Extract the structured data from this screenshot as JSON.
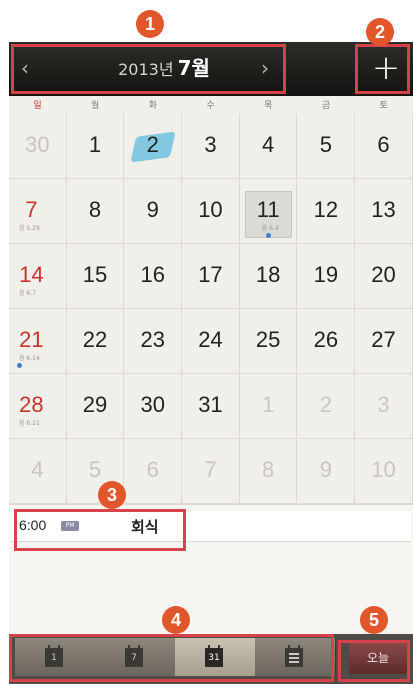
{
  "header": {
    "prev_icon": "chevron-left-icon",
    "next_icon": "chevron-right-icon",
    "year_label": "2013년",
    "month_label": "7월",
    "add_label": "+"
  },
  "weekdays": [
    "일",
    "월",
    "화",
    "수",
    "목",
    "금",
    "토"
  ],
  "weeks": [
    [
      {
        "d": "30",
        "o": true
      },
      {
        "d": "1"
      },
      {
        "d": "2",
        "today": true
      },
      {
        "d": "3"
      },
      {
        "d": "4"
      },
      {
        "d": "5"
      },
      {
        "d": "6"
      }
    ],
    [
      {
        "d": "7",
        "s": true,
        "l": "음 5.29"
      },
      {
        "d": "8"
      },
      {
        "d": "9"
      },
      {
        "d": "10"
      },
      {
        "d": "11",
        "sel": true,
        "l": "음 6.4",
        "dot": true
      },
      {
        "d": "12"
      },
      {
        "d": "13"
      }
    ],
    [
      {
        "d": "14",
        "s": true,
        "l": "음 6.7"
      },
      {
        "d": "15"
      },
      {
        "d": "16"
      },
      {
        "d": "17"
      },
      {
        "d": "18"
      },
      {
        "d": "19"
      },
      {
        "d": "20"
      }
    ],
    [
      {
        "d": "21",
        "s": true,
        "l": "음 6.14",
        "dot": true
      },
      {
        "d": "22"
      },
      {
        "d": "23"
      },
      {
        "d": "24"
      },
      {
        "d": "25"
      },
      {
        "d": "26"
      },
      {
        "d": "27"
      }
    ],
    [
      {
        "d": "28",
        "s": true,
        "l": "음 6.21"
      },
      {
        "d": "29"
      },
      {
        "d": "30"
      },
      {
        "d": "31"
      },
      {
        "d": "1",
        "o": true
      },
      {
        "d": "2",
        "o": true
      },
      {
        "d": "3",
        "o": true
      }
    ],
    [
      {
        "d": "4",
        "o": true
      },
      {
        "d": "5",
        "o": true
      },
      {
        "d": "6",
        "o": true
      },
      {
        "d": "7",
        "o": true
      },
      {
        "d": "8",
        "o": true
      },
      {
        "d": "9",
        "o": true
      },
      {
        "d": "10",
        "o": true
      }
    ]
  ],
  "event": {
    "time": "6:00",
    "ampm": "PM",
    "title": "회식"
  },
  "bottom_tabs": [
    {
      "label": "1",
      "name": "tab-day-view"
    },
    {
      "label": "7",
      "name": "tab-week-view"
    },
    {
      "label": "31",
      "name": "tab-month-view",
      "active": true
    },
    {
      "label": "",
      "name": "tab-list-view"
    }
  ],
  "today_button": "오늘",
  "callouts": [
    "1",
    "2",
    "3",
    "4",
    "5"
  ],
  "colors": {
    "accent": "#e2562c",
    "highlight_border": "#d7424a",
    "sunday": "#c7332e",
    "event_dot": "#3e7dd1"
  }
}
